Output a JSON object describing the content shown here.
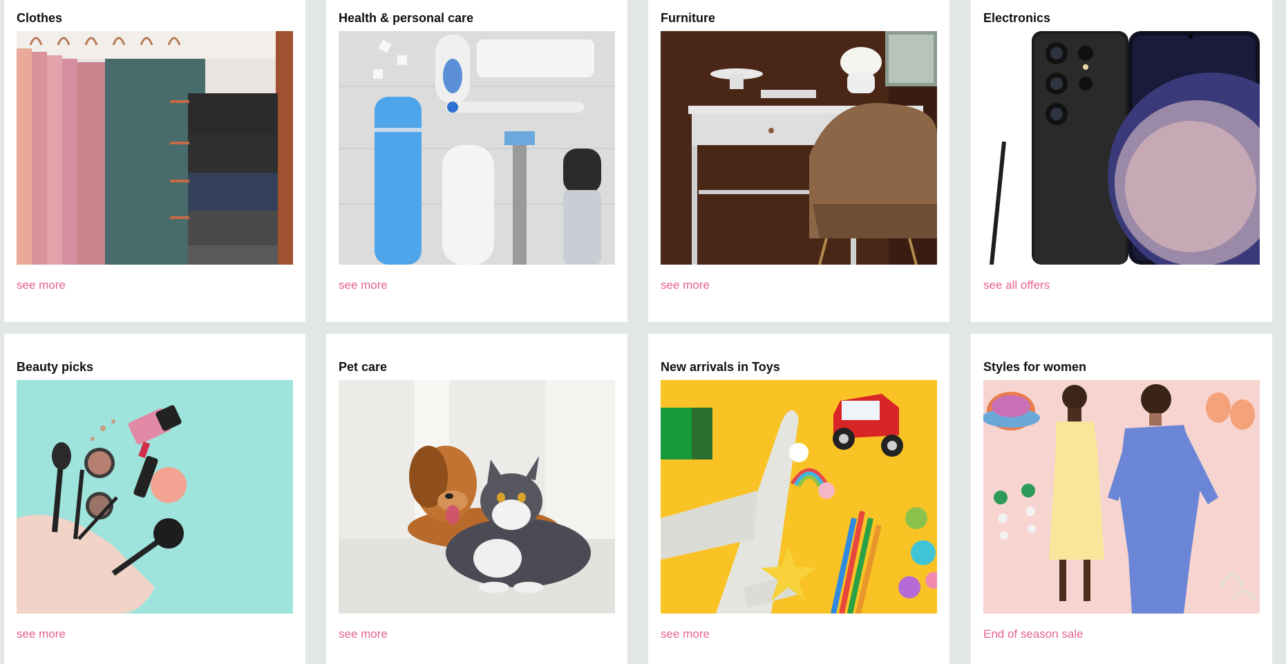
{
  "cards": [
    {
      "title": "Clothes",
      "link": "see more",
      "image": "clothes-image"
    },
    {
      "title": "Health & personal care",
      "link": "see more",
      "image": "health-care-image"
    },
    {
      "title": "Furniture",
      "link": "see more",
      "image": "furniture-image"
    },
    {
      "title": "Electronics",
      "link": "see all offers",
      "image": "electronics-image"
    },
    {
      "title": "Beauty picks",
      "link": "see more",
      "image": "beauty-image"
    },
    {
      "title": "Pet care",
      "link": "see more",
      "image": "pet-care-image"
    },
    {
      "title": "New arrivals in Toys",
      "link": "see more",
      "image": "toys-image"
    },
    {
      "title": "Styles for women",
      "link": "End of season sale",
      "image": "womens-styles-image"
    }
  ],
  "colors": {
    "page_background": "#e3e6e6",
    "card_background": "#ffffff",
    "title_text": "#0f1111",
    "link_text": "#e5618b"
  }
}
